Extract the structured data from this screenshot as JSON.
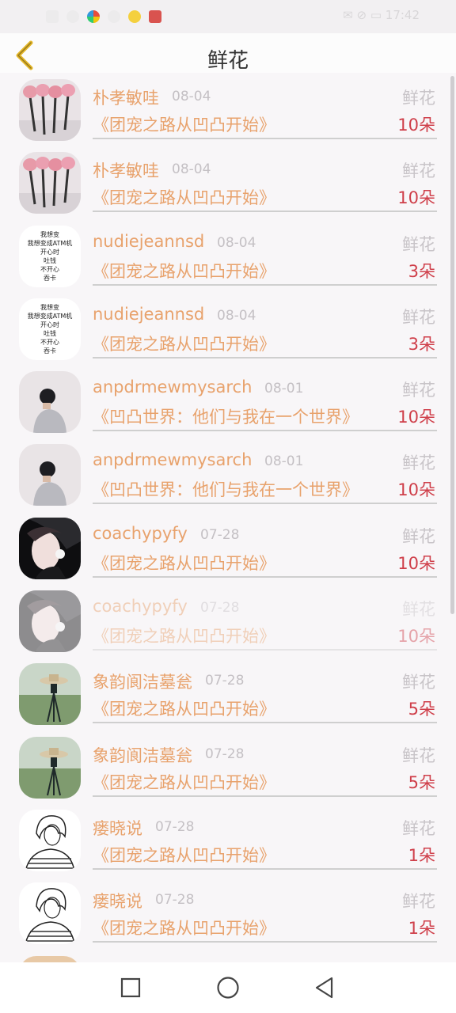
{
  "status_bar": {
    "right_text": "✉ ⊘ ▭ 17:42"
  },
  "header": {
    "title": "鲜花"
  },
  "rows": [
    {
      "name": "朴孝敏哇",
      "date": "08-04",
      "gift": "鲜花",
      "book": "《团宠之路从凹凸开始》",
      "count": "10朵",
      "avatar": "roses",
      "faded": false
    },
    {
      "name": "朴孝敏哇",
      "date": "08-04",
      "gift": "鲜花",
      "book": "《团宠之路从凹凸开始》",
      "count": "10朵",
      "avatar": "roses",
      "faded": false
    },
    {
      "name": "nudiejeannsd",
      "date": "08-04",
      "gift": "鲜花",
      "book": "《团宠之路从凹凸开始》",
      "count": "3朵",
      "avatar": "text",
      "faded": false,
      "avatar_text": [
        "我想变",
        "我想变成ATM机",
        "开心时",
        "吐钱",
        "不开心",
        "吞卡"
      ]
    },
    {
      "name": "nudiejeannsd",
      "date": "08-04",
      "gift": "鲜花",
      "book": "《团宠之路从凹凸开始》",
      "count": "3朵",
      "avatar": "text",
      "faded": false,
      "avatar_text": [
        "我想变",
        "我想变成ATM机",
        "开心时",
        "吐钱",
        "不开心",
        "吞卡"
      ]
    },
    {
      "name": "anpdrmewmysarch",
      "date": "08-01",
      "gift": "鲜花",
      "book": "《凹凸世界：他们与我在一个世界》",
      "count": "10朵",
      "avatar": "boy",
      "faded": false
    },
    {
      "name": "anpdrmewmysarch",
      "date": "08-01",
      "gift": "鲜花",
      "book": "《凹凸世界：他们与我在一个世界》",
      "count": "10朵",
      "avatar": "boy",
      "faded": false
    },
    {
      "name": "coachypyfy",
      "date": "07-28",
      "gift": "鲜花",
      "book": "《团宠之路从凹凸开始》",
      "count": "10朵",
      "avatar": "portrait",
      "faded": false
    },
    {
      "name": "coachypyfy",
      "date": "07-28",
      "gift": "鲜花",
      "book": "《团宠之路从凹凸开始》",
      "count": "10朵",
      "avatar": "portrait",
      "faded": true
    },
    {
      "name": "象韵阆洁墓瓮",
      "date": "07-28",
      "gift": "鲜花",
      "book": "《团宠之路从凹凸开始》",
      "count": "5朵",
      "avatar": "field",
      "faded": false
    },
    {
      "name": "象韵阆洁墓瓮",
      "date": "07-28",
      "gift": "鲜花",
      "book": "《团宠之路从凹凸开始》",
      "count": "5朵",
      "avatar": "field",
      "faded": false
    },
    {
      "name": "瘘晓说",
      "date": "07-28",
      "gift": "鲜花",
      "book": "《团宠之路从凹凸开始》",
      "count": "1朵",
      "avatar": "sketch",
      "faded": false
    },
    {
      "name": "瘘晓说",
      "date": "07-28",
      "gift": "鲜花",
      "book": "《团宠之路从凹凸开始》",
      "count": "1朵",
      "avatar": "sketch",
      "faded": false
    }
  ],
  "colors": {
    "name": "#e8a26c",
    "count": "#cf3f4a",
    "back_arrow": "#e3b628"
  },
  "nav": {
    "icons": [
      "square-icon",
      "circle-icon",
      "triangle-back-icon"
    ]
  }
}
